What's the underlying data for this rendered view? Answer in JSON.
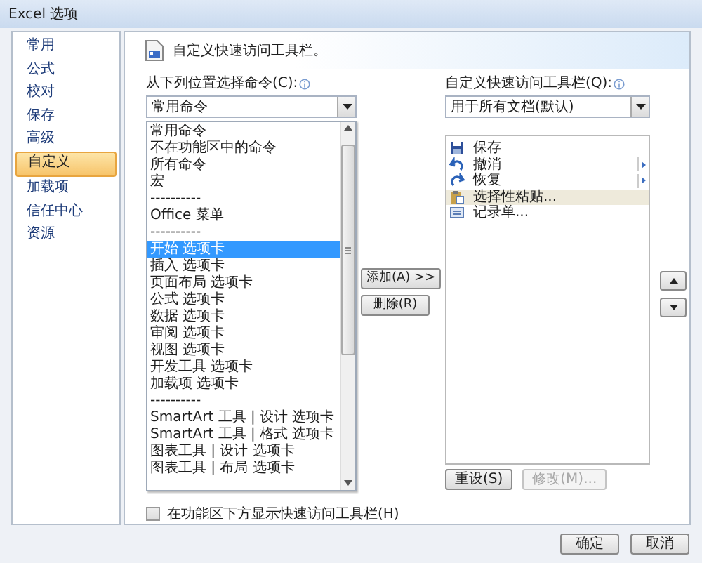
{
  "window": {
    "title": "Excel 选项"
  },
  "sidebar": {
    "items": [
      {
        "label": "常用",
        "selected": false
      },
      {
        "label": "公式",
        "selected": false
      },
      {
        "label": "校对",
        "selected": false
      },
      {
        "label": "保存",
        "selected": false
      },
      {
        "label": "高级",
        "selected": false
      },
      {
        "label": "自定义",
        "selected": true
      },
      {
        "label": "加载项",
        "selected": false
      },
      {
        "label": "信任中心",
        "selected": false
      },
      {
        "label": "资源",
        "selected": false
      }
    ]
  },
  "header": {
    "title": "自定义快速访问工具栏。"
  },
  "commands": {
    "label": "从下列位置选择命令(C):",
    "dropdown": {
      "value": "常用命令"
    },
    "items": [
      {
        "label": "常用命令",
        "selected": false
      },
      {
        "label": "不在功能区中的命令",
        "selected": false
      },
      {
        "label": "所有命令",
        "selected": false
      },
      {
        "label": "宏",
        "selected": false
      },
      {
        "label": "----------",
        "selected": false
      },
      {
        "label": "Office 菜单",
        "selected": false
      },
      {
        "label": "----------",
        "selected": false
      },
      {
        "label": "开始 选项卡",
        "selected": true
      },
      {
        "label": "插入 选项卡",
        "selected": false
      },
      {
        "label": "页面布局 选项卡",
        "selected": false
      },
      {
        "label": "公式 选项卡",
        "selected": false
      },
      {
        "label": "数据 选项卡",
        "selected": false
      },
      {
        "label": "审阅 选项卡",
        "selected": false
      },
      {
        "label": "视图 选项卡",
        "selected": false
      },
      {
        "label": "开发工具 选项卡",
        "selected": false
      },
      {
        "label": "加载项 选项卡",
        "selected": false
      },
      {
        "label": "----------",
        "selected": false
      },
      {
        "label": "SmartArt 工具 | 设计 选项卡",
        "selected": false
      },
      {
        "label": "SmartArt 工具 | 格式 选项卡",
        "selected": false
      },
      {
        "label": "图表工具 | 设计 选项卡",
        "selected": false
      },
      {
        "label": "图表工具 | 布局 选项卡",
        "selected": false
      }
    ]
  },
  "add_button": {
    "label": "添加(A) >>"
  },
  "remove_button": {
    "label": "删除(R)"
  },
  "quick_access": {
    "label": "自定义快速访问工具栏(Q):",
    "dropdown": {
      "value": "用于所有文档(默认)"
    },
    "items": [
      {
        "label": "保存",
        "kind": "save",
        "submenu": false,
        "selected": false
      },
      {
        "label": "撤消",
        "kind": "undo",
        "submenu": true,
        "selected": false
      },
      {
        "label": "恢复",
        "kind": "redo",
        "submenu": true,
        "selected": false
      },
      {
        "label": "选择性粘贴...",
        "kind": "paste",
        "submenu": false,
        "selected": true
      },
      {
        "label": "记录单...",
        "kind": "form",
        "submenu": false,
        "selected": false
      }
    ]
  },
  "reset_button": {
    "label": "重设(S)",
    "disabled": false
  },
  "modify_button": {
    "label": "修改(M)...",
    "disabled": true
  },
  "checkbox": {
    "label": "在功能区下方显示快速访问工具栏(H)",
    "checked": false
  },
  "footer": {
    "buttons": [
      {
        "label": "确定"
      },
      {
        "label": "取消"
      }
    ]
  }
}
